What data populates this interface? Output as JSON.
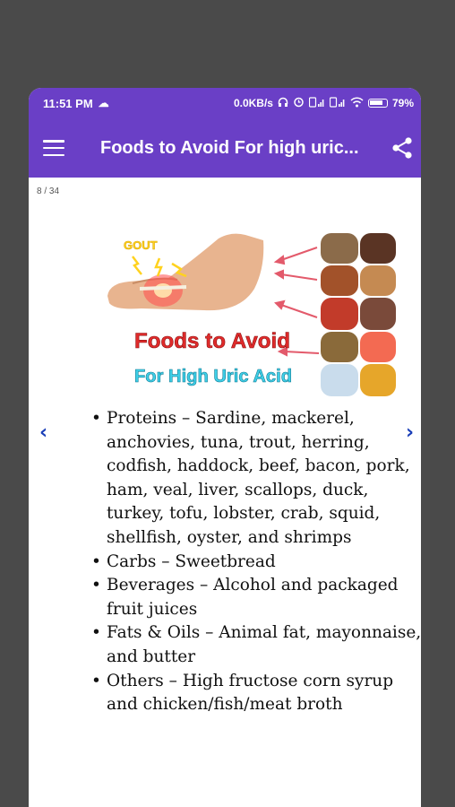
{
  "status_bar": {
    "time": "11:51 PM",
    "network_speed": "0.0KB/s",
    "battery_percent": "79%",
    "icons": [
      "cloud-icon",
      "headphones-icon",
      "alarm-icon",
      "sim-signal-icon",
      "sim-signal-icon",
      "wifi-icon",
      "battery-icon"
    ]
  },
  "app_bar": {
    "title": "Foods to Avoid For high uric...",
    "menu_icon": "hamburger-menu-icon",
    "share_icon": "share-icon"
  },
  "page_counter": "8 / 34",
  "figure": {
    "gout_label": "GOUT",
    "heading_line1": "Foods to Avoid",
    "heading_line2": "For High Uric Acid"
  },
  "content": {
    "items": [
      "Proteins – Sardine, mackerel, anchovies, tuna, trout, herring, codfish, haddock, beef, bacon, pork, ham, veal, liver, scallops, duck, turkey, tofu, lobster, crab, squid, shellfish, oyster, and shrimps",
      "Carbs – Sweetbread",
      "Beverages – Alcohol and packaged fruit juices",
      "Fats & Oils – Animal fat, mayonnaise, and butter",
      "Others – High fructose corn syrup and chicken/fish/meat broth"
    ]
  },
  "navigation": {
    "prev": "‹",
    "next": "›"
  },
  "colors": {
    "primary": "#6a3fc6",
    "arrow": "#1a3fb8",
    "heading_red": "#e02b2b",
    "heading_cyan": "#3fd0e8"
  }
}
